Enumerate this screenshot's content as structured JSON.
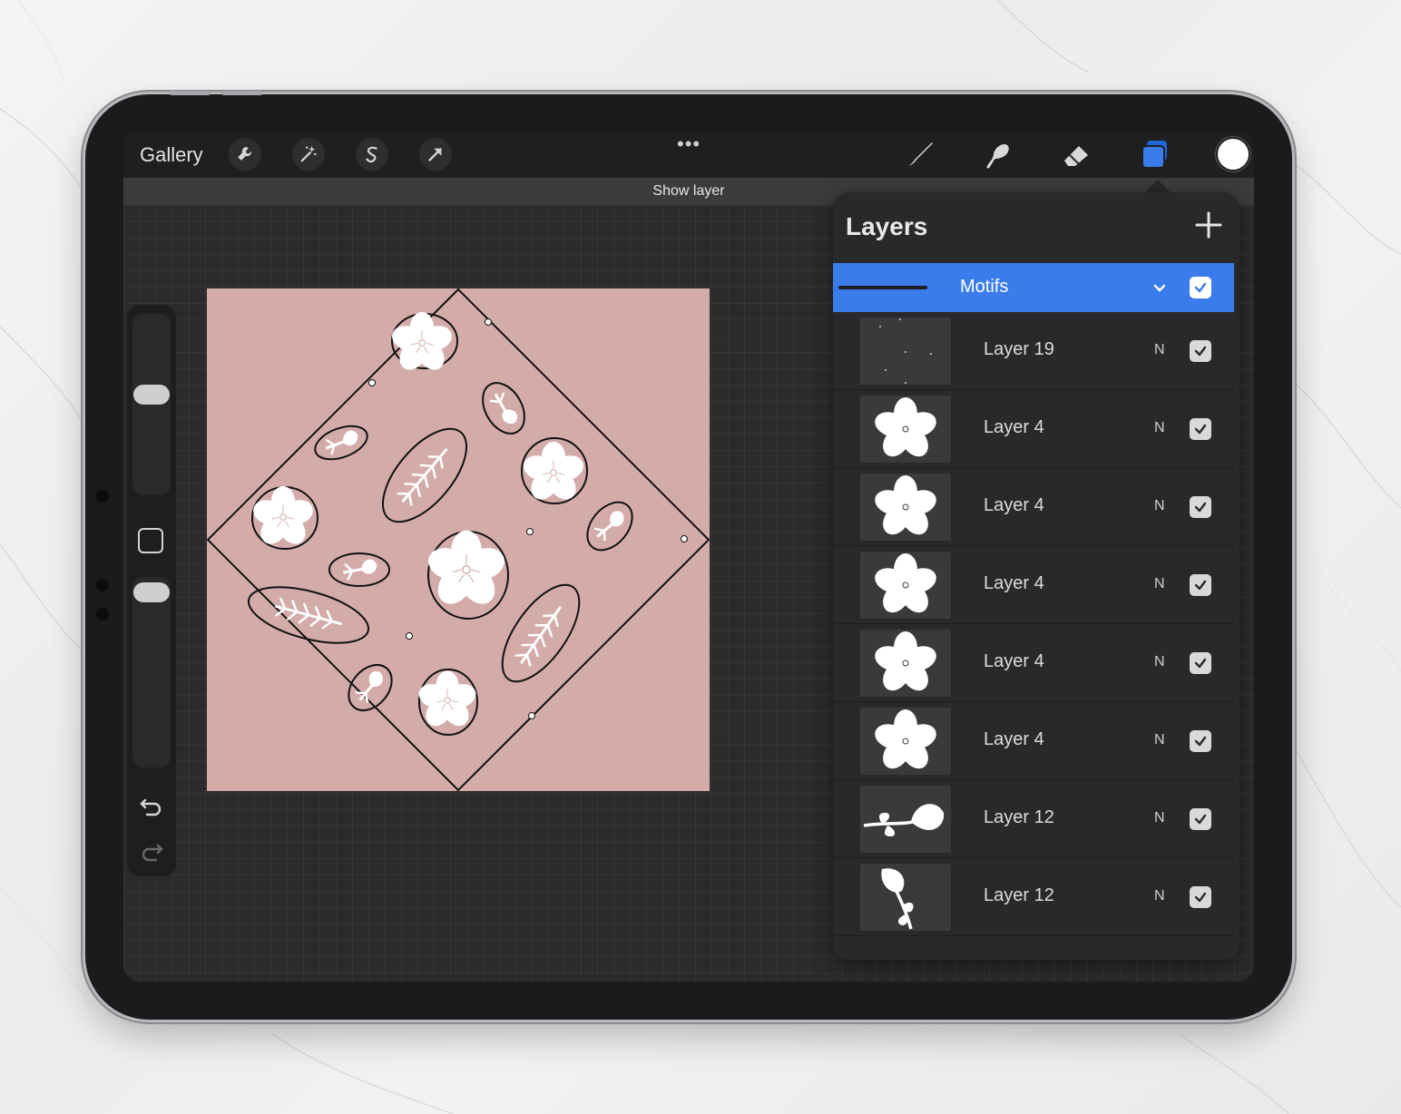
{
  "toolbar": {
    "gallery_label": "Gallery",
    "more_label": "•••",
    "color": "#ffffff"
  },
  "toast": {
    "text": "Show layer"
  },
  "layers_panel": {
    "title": "Layers",
    "group": {
      "name": "Motifs",
      "visible": true
    },
    "layers": [
      {
        "name": "Layer 19",
        "blend": "N",
        "visible": true,
        "thumb": "dots"
      },
      {
        "name": "Layer 4",
        "blend": "N",
        "visible": true,
        "thumb": "flower"
      },
      {
        "name": "Layer 4",
        "blend": "N",
        "visible": true,
        "thumb": "flower"
      },
      {
        "name": "Layer 4",
        "blend": "N",
        "visible": true,
        "thumb": "flower"
      },
      {
        "name": "Layer 4",
        "blend": "N",
        "visible": true,
        "thumb": "flower"
      },
      {
        "name": "Layer 4",
        "blend": "N",
        "visible": true,
        "thumb": "flower"
      },
      {
        "name": "Layer 12",
        "blend": "N",
        "visible": true,
        "thumb": "sprig"
      },
      {
        "name": "Layer 12",
        "blend": "N",
        "visible": true,
        "thumb": "sprig2"
      }
    ]
  },
  "colors": {
    "accent": "#3a7ce9",
    "canvas": "#d3acaa",
    "panel": "#29292b"
  },
  "icons": {
    "actions": "wrench-icon",
    "adjustments": "magic-wand-icon",
    "selection": "selection-s-icon",
    "transform": "arrow-icon",
    "brush": "brush-icon",
    "smudge": "smudge-icon",
    "eraser": "eraser-icon",
    "layers": "layers-icon"
  }
}
